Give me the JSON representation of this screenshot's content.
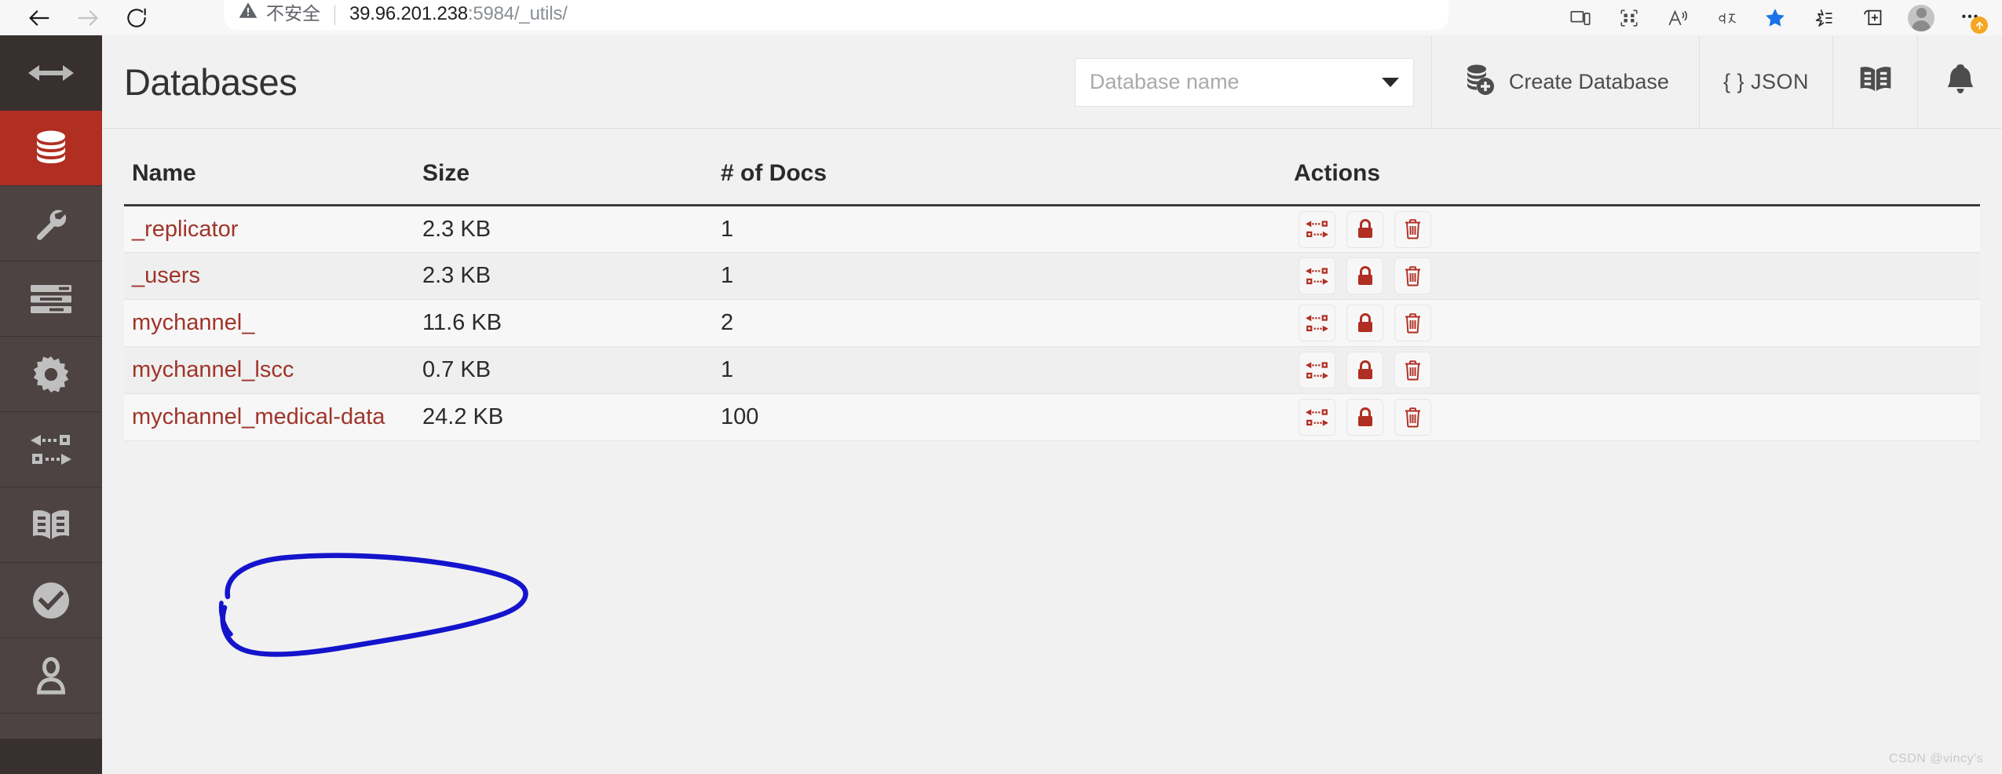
{
  "browser": {
    "nav": {
      "back_icon": "arrow-left-icon",
      "forward_icon": "arrow-right-icon",
      "reload_icon": "reload-icon"
    },
    "omnibox": {
      "security_label": "不安全",
      "url_host": "39.96.201.238",
      "url_port": ":5984",
      "url_path": "/_utils/",
      "warning_icon": "warning-triangle-icon"
    },
    "toolbar_icons": [
      "device-cast-icon",
      "split-screen-icon",
      "read-aloud-icon",
      "translate-icon",
      "favorite-star-icon",
      "collections-icon",
      "add-tab-group-icon",
      "profile-avatar-icon",
      "more-options-icon"
    ]
  },
  "sidebar": {
    "items": [
      {
        "name": "sidebar-toggle",
        "icon": "double-arrow-horizontal-icon",
        "active": false,
        "top": true
      },
      {
        "name": "sidebar-item-databases",
        "icon": "database-icon",
        "active": true,
        "top": false
      },
      {
        "name": "sidebar-item-setup",
        "icon": "wrench-icon",
        "active": false,
        "top": false
      },
      {
        "name": "sidebar-item-activity",
        "icon": "list-bars-icon",
        "active": false,
        "top": false
      },
      {
        "name": "sidebar-item-config",
        "icon": "gear-icon",
        "active": false,
        "top": false
      },
      {
        "name": "sidebar-item-replication",
        "icon": "replication-arrows-icon",
        "active": false,
        "top": false
      },
      {
        "name": "sidebar-item-docs",
        "icon": "open-book-icon",
        "active": false,
        "top": false
      },
      {
        "name": "sidebar-item-verify",
        "icon": "check-circle-icon",
        "active": false,
        "top": false
      },
      {
        "name": "sidebar-item-account",
        "icon": "user-icon",
        "active": false,
        "top": false
      }
    ]
  },
  "header": {
    "title": "Databases",
    "search": {
      "placeholder": "Database name",
      "value": "",
      "caret_icon": "chevron-down-icon"
    },
    "create_button": {
      "label": "Create Database",
      "icon": "database-add-icon"
    },
    "json_button": {
      "label": "{ } JSON",
      "icon": "json-braces-icon"
    },
    "docs_button": {
      "icon": "open-book-icon"
    },
    "notifications_button": {
      "icon": "bell-icon"
    }
  },
  "table": {
    "columns": [
      "Name",
      "Size",
      "# of Docs",
      "Actions"
    ],
    "row_actions": [
      {
        "name": "replicate-button",
        "icon": "replication-arrows-icon"
      },
      {
        "name": "permissions-button",
        "icon": "lock-icon"
      },
      {
        "name": "delete-button",
        "icon": "trash-icon"
      }
    ],
    "rows": [
      {
        "name": "_replicator",
        "size": "2.3 KB",
        "docs": "1"
      },
      {
        "name": "_users",
        "size": "2.3 KB",
        "docs": "1"
      },
      {
        "name": "mychannel_",
        "size": "11.6 KB",
        "docs": "2"
      },
      {
        "name": "mychannel_lscc",
        "size": "0.7 KB",
        "docs": "1"
      },
      {
        "name": "mychannel_medical-data",
        "size": "24.2 KB",
        "docs": "100"
      }
    ]
  },
  "annotation": {
    "shape": "hand-drawn-ellipse",
    "color": "#1414cc",
    "target_row": "mychannel_medical-data"
  },
  "watermark": {
    "text": "CSDN @vincy's"
  },
  "colors": {
    "accent_red": "#b02e22",
    "link_red": "#a0342a",
    "sidebar_bg": "#4d4343",
    "sidebar_dark": "#382f2f",
    "page_bg": "#f1f1f1",
    "row_odd": "#f7f7f7",
    "row_even": "#efefef",
    "annotation_blue": "#1414cc"
  }
}
